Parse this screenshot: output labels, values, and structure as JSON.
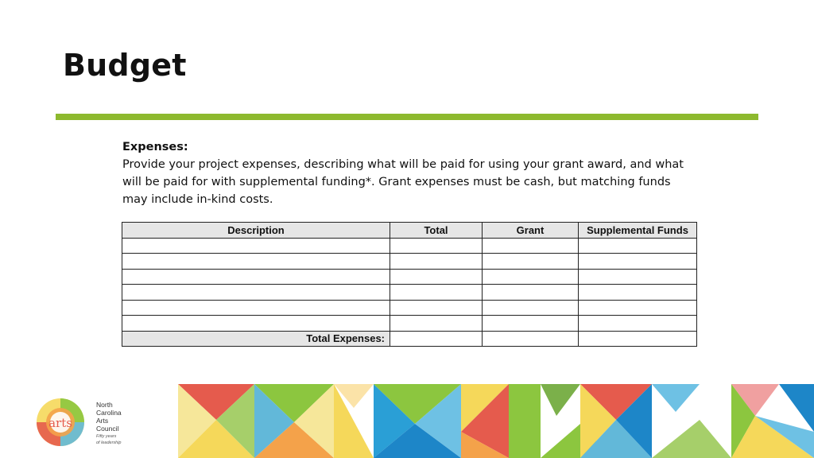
{
  "slide": {
    "title": "Budget"
  },
  "intro": {
    "heading": "Expenses:",
    "body": "Provide your project expenses, describing what will be paid for using your grant award, and what will be paid for with supplemental funding*. Grant expenses must be cash, but matching funds may include in-kind costs."
  },
  "table": {
    "headers": [
      "Description",
      "Total",
      "Grant",
      "Supplemental Funds"
    ],
    "empty_rows": 6,
    "total_label": "Total Expenses:"
  },
  "footer": {
    "logo_text": "arts",
    "org_lines": [
      "North",
      "Carolina",
      "Arts",
      "Council"
    ],
    "tagline": [
      "Fifty years",
      "of leadership"
    ]
  },
  "colors": {
    "title_rule": "#8db92e",
    "header_fill": "#e6e6e6"
  }
}
